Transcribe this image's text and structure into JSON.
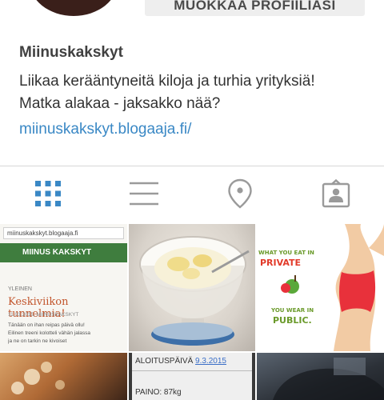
{
  "profile": {
    "edit_button_label": "MUOKKAA PROFIILIASI",
    "username": "Miinuskakskyt",
    "bio_lines": [
      "Liikaa kerääntyneitä kiloja ja turhia yrityksiä!",
      "Matka alakaa - jaksakko nää?"
    ],
    "website": "miinuskakskyt.blogaaja.fi/"
  },
  "tabs": [
    {
      "icon": "grid-icon",
      "active": true
    },
    {
      "icon": "list-icon",
      "active": false
    },
    {
      "icon": "location-pin-icon",
      "active": false
    },
    {
      "icon": "tagged-photos-icon",
      "active": false
    }
  ],
  "colors": {
    "link": "#3a88c5",
    "active_tab": "#3a88c5",
    "inactive_tab": "#9a9a9a",
    "edit_button_bg": "#eeeeee"
  },
  "posts": {
    "blog_screenshot": {
      "url_bar": "miinuskakskyt.blogaaja.fi",
      "header": "MIINUS KAKSKYT",
      "category": "YLEINEN",
      "title": "Keskiviikon tunnelmia!",
      "date": "11.03.2015, MIINUSKAKSKYT",
      "text_lines": [
        "Tänään on ihan reipas päivä ollu!",
        "Eilinen treeni kolotteli vähän jalassa",
        "ja ne on tarkin ne kivoiset"
      ]
    },
    "cartoon": {
      "line1": "WHAT YOU EAT IN",
      "line2": "PRIVATE",
      "line3": "YOU WEAR IN",
      "line4": "PUBLIC."
    },
    "note": {
      "start_label": "ALOITUSPÄIVÄ",
      "start_date": "9.3.2015",
      "weight": "PAINO: 87kg"
    }
  }
}
